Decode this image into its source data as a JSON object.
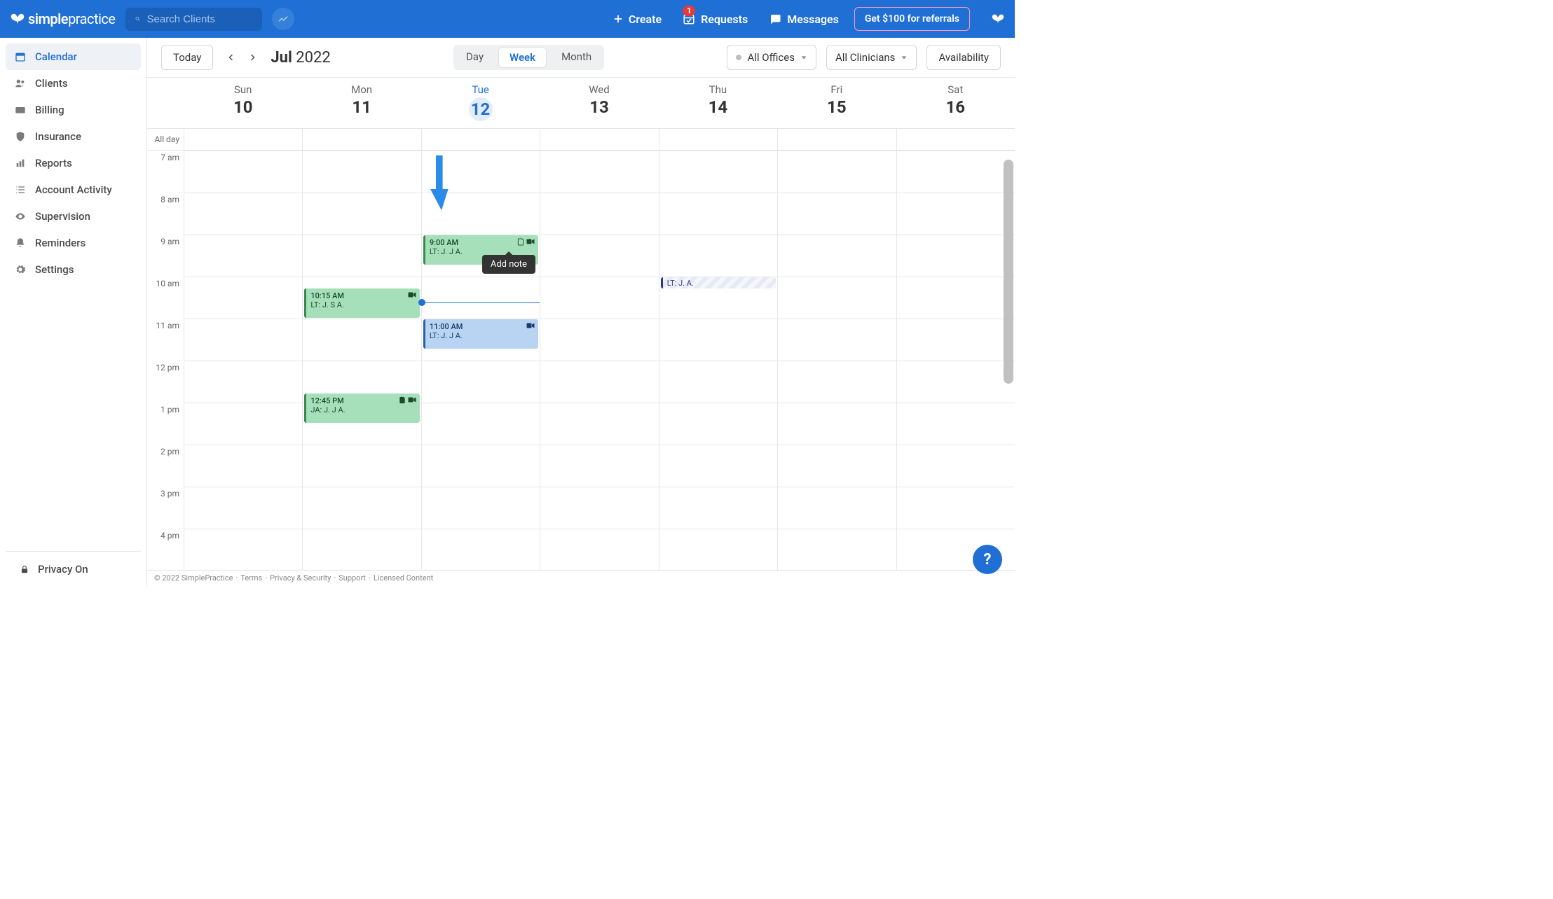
{
  "header": {
    "brand": "simplepractice",
    "search_placeholder": "Search Clients",
    "create": "Create",
    "requests": "Requests",
    "requests_badge": "1",
    "messages": "Messages",
    "referral": "Get $100 for referrals"
  },
  "sidebar": {
    "items": [
      {
        "label": "Calendar"
      },
      {
        "label": "Clients"
      },
      {
        "label": "Billing"
      },
      {
        "label": "Insurance"
      },
      {
        "label": "Reports"
      },
      {
        "label": "Account Activity"
      },
      {
        "label": "Supervision"
      },
      {
        "label": "Reminders"
      },
      {
        "label": "Settings"
      }
    ],
    "privacy": "Privacy On"
  },
  "toolbar": {
    "today": "Today",
    "month_bold": "Jul",
    "month_rest": " 2022",
    "views": {
      "day": "Day",
      "week": "Week",
      "month": "Month"
    },
    "filters": {
      "offices": "All Offices",
      "clinicians": "All Clinicians"
    },
    "availability": "Availability"
  },
  "calendar": {
    "allday": "All day",
    "days": [
      {
        "name": "Sun",
        "num": "10"
      },
      {
        "name": "Mon",
        "num": "11"
      },
      {
        "name": "Tue",
        "num": "12"
      },
      {
        "name": "Wed",
        "num": "13"
      },
      {
        "name": "Thu",
        "num": "14"
      },
      {
        "name": "Fri",
        "num": "15"
      },
      {
        "name": "Sat",
        "num": "16"
      }
    ],
    "hours": [
      "7 am",
      "8 am",
      "9 am",
      "10 am",
      "11 am",
      "12 pm",
      "1 pm",
      "2 pm",
      "3 pm",
      "4 pm"
    ],
    "events": {
      "mon_1015": {
        "time": "10:15 AM",
        "title": "LT: J. S A."
      },
      "mon_1245": {
        "time": "12:45 PM",
        "title": "JA: J. J A."
      },
      "tue_900": {
        "time": "9:00 AM",
        "title": "LT: J. J A."
      },
      "tue_1100": {
        "time": "11:00 AM",
        "title": "LT: J. J A."
      },
      "thu_10": {
        "title": "LT: J. A."
      }
    },
    "tooltip": "Add note"
  },
  "footer": {
    "copyright": "© 2022 SimplePractice",
    "terms": "Terms",
    "privacy": "Privacy & Security",
    "support": "Support",
    "licensed": "Licensed Content"
  },
  "help": "?"
}
